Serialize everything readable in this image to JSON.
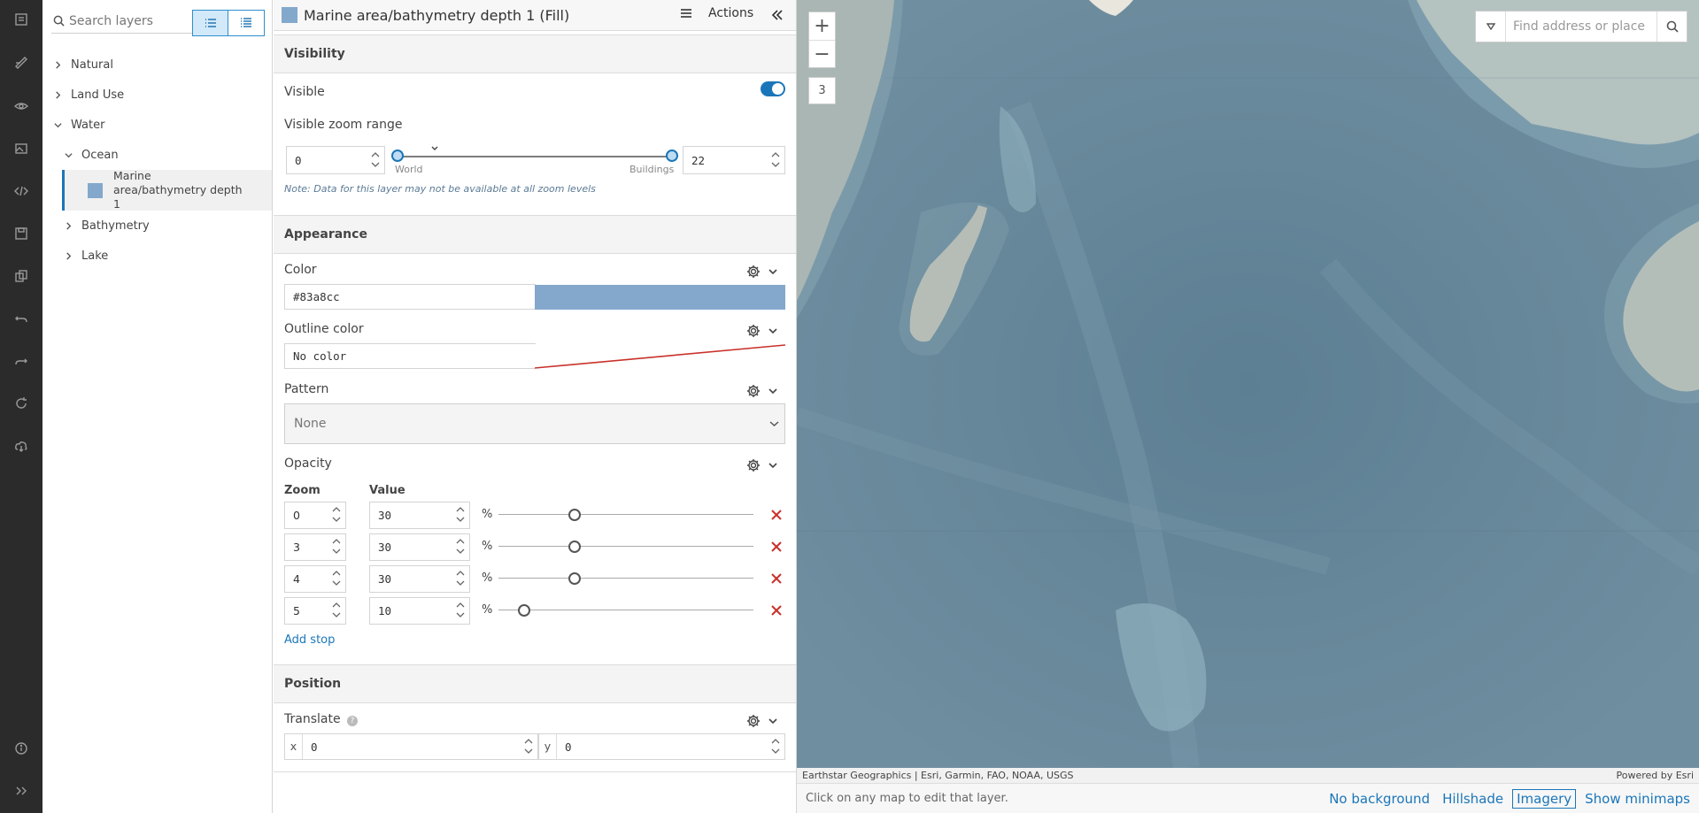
{
  "rail": {
    "icons": [
      "layers-icon",
      "edit-style-icon",
      "eye-icon",
      "images-icon",
      "code-icon",
      "save-icon",
      "copy-icon",
      "undo-icon",
      "redo-icon",
      "refresh-icon",
      "cloud-download-icon",
      "info-icon",
      "expand-icon"
    ]
  },
  "layers_panel": {
    "search_placeholder": "Search layers",
    "tree": [
      {
        "label": "Natural",
        "level": 0,
        "expanded": false
      },
      {
        "label": "Land Use",
        "level": 0,
        "expanded": false
      },
      {
        "label": "Water",
        "level": 0,
        "expanded": true
      },
      {
        "label": "Ocean",
        "level": 1,
        "expanded": true
      },
      {
        "label": "Marine area/bathymetry depth 1",
        "level": 2,
        "selected": true,
        "swatch": "#83a8cc"
      },
      {
        "label": "Bathymetry",
        "level": 1,
        "expanded": false
      },
      {
        "label": "Lake",
        "level": 1,
        "expanded": false
      }
    ]
  },
  "props": {
    "title": "Marine area/bathymetry depth 1 (Fill)",
    "actions_label": "Actions",
    "visibility": {
      "section": "Visibility",
      "visible_label": "Visible",
      "visible": true,
      "zoom_range_label": "Visible zoom range",
      "min_zoom": "0",
      "max_zoom": "22",
      "world_label": "World",
      "buildings_label": "Buildings",
      "note": "Note: Data for this layer may not be available at all zoom levels"
    },
    "appearance": {
      "section": "Appearance",
      "color_label": "Color",
      "color_value": "#83a8cc",
      "outline_label": "Outline color",
      "outline_value": "No color",
      "pattern_label": "Pattern",
      "pattern_value": "None",
      "opacity_label": "Opacity",
      "zoom_header": "Zoom",
      "value_header": "Value",
      "percent": "%",
      "stops": [
        {
          "zoom": "0",
          "value": "30"
        },
        {
          "zoom": "3",
          "value": "30"
        },
        {
          "zoom": "4",
          "value": "30"
        },
        {
          "zoom": "5",
          "value": "10"
        }
      ],
      "add_stop": "Add stop"
    },
    "position": {
      "section": "Position",
      "translate_label": "Translate",
      "x_label": "x",
      "x_value": "0",
      "y_label": "y",
      "y_value": "0"
    }
  },
  "map": {
    "zoom_in": "+",
    "zoom_out": "−",
    "zoom_level": "3",
    "search_placeholder": "Find address or place",
    "attribution": "Earthstar Geographics | Esri, Garmin, FAO, NOAA, USGS",
    "powered_by": "Powered by Esri",
    "hint": "Click on any map to edit that layer.",
    "background_options": [
      "No background",
      "Hillshade",
      "Imagery",
      "Show minimaps"
    ],
    "active_background": "Imagery"
  },
  "colors": {
    "accent": "#1b76b9",
    "layer_fill": "#83a8cc",
    "remove": "#c8322b",
    "rail": "#2b2b2b"
  }
}
